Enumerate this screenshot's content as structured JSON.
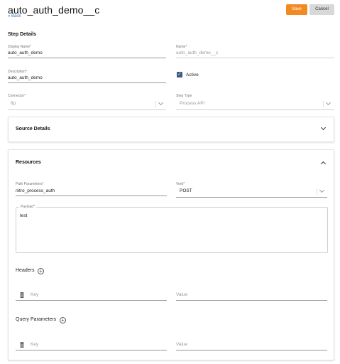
{
  "header": {
    "title": "auto_auth_demo__c",
    "back_label": "« Back",
    "save_label": "Save",
    "cancel_label": "Cancel",
    "save_color": "#f28a24"
  },
  "step_details": {
    "heading": "Step Details",
    "display_name_label": "Display Name*",
    "display_name_value": "auto_auth_demo",
    "name_label": "Name*",
    "name_value": "auto_auth_demo__c",
    "description_label": "Description*",
    "description_value": "auto_auth_demo",
    "active_label": "Active",
    "active_checked": true,
    "connector_label": "Connector*",
    "connector_value": "ftp",
    "step_type_label": "Step Type",
    "step_type_value": "Process API"
  },
  "source_details": {
    "heading": "Source Details",
    "icon": "chevron-down-icon"
  },
  "resources": {
    "heading": "Resources",
    "icon": "chevron-up-icon",
    "path_parameters_label": "Path Parameters*",
    "path_parameters_value": "nitro_process_auth",
    "verb_label": "Verb*",
    "verb_value": "POST",
    "payload_label": "Payload*",
    "payload_value": "test",
    "headers_label": "Headers",
    "headers_key_placeholder": "Key",
    "headers_value_placeholder": "Value",
    "query_parameters_label": "Query Parameters",
    "query_key_placeholder": "Key",
    "query_value_placeholder": "Value"
  }
}
